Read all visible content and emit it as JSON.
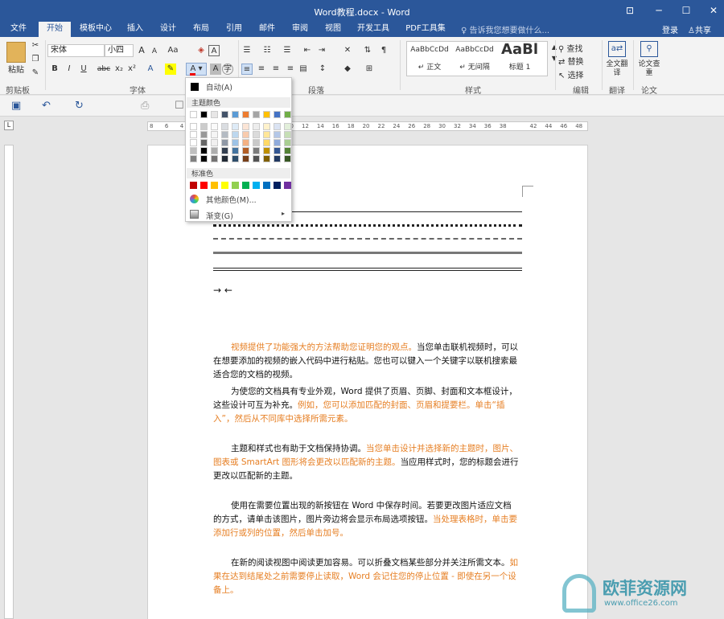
{
  "title": "Word教程.docx - Word",
  "window_controls": [
    "⊡",
    "─",
    "☐",
    "✕"
  ],
  "tabs": [
    "文件",
    "开始",
    "模板中心",
    "插入",
    "设计",
    "布局",
    "引用",
    "邮件",
    "审阅",
    "视图",
    "开发工具",
    "PDF工具集"
  ],
  "tellme": "告诉我您想要做什么...",
  "login": "登录",
  "share": "共享",
  "clipboard": {
    "paste": "粘贴",
    "label": "剪贴板"
  },
  "font": {
    "name": "宋体",
    "size": "小四",
    "label": "字体",
    "grow": "A",
    "shrink": "A",
    "case": "Aa",
    "bold": "B",
    "italic": "I",
    "underline": "U",
    "strike": "abc",
    "sub": "x₂",
    "sup": "x²"
  },
  "paragraph": {
    "label": "段落"
  },
  "styles": {
    "label": "样式",
    "items": [
      {
        "preview": "AaBbCcDd",
        "name": "↵ 正文"
      },
      {
        "preview": "AaBbCcDd",
        "name": "↵ 无间隔"
      },
      {
        "preview": "AaBl",
        "name": "标题 1"
      }
    ]
  },
  "editing": {
    "label": "编辑",
    "find": "查找",
    "replace": "替换",
    "select": "选择"
  },
  "translate": {
    "label": "翻译",
    "btn": "全文翻译"
  },
  "paper": {
    "label": "论文",
    "btn": "论文查重"
  },
  "ruler_ticks": [
    "8",
    "6",
    "4",
    "2",
    "",
    "2",
    "4",
    "6",
    "8",
    "10",
    "12",
    "14",
    "16",
    "18",
    "20",
    "22",
    "24",
    "26",
    "28",
    "30",
    "32",
    "34",
    "36",
    "38",
    "",
    "42",
    "44",
    "46",
    "48"
  ],
  "color_menu": {
    "auto": "自动(A)",
    "theme_title": "主题颜色",
    "standard_title": "标准色",
    "more": "其他颜色(M)...",
    "gradient": "渐变(G)",
    "theme_colors": [
      "#ffffff",
      "#000000",
      "#e7e6e6",
      "#44546a",
      "#5b9bd5",
      "#ed7d31",
      "#a5a5a5",
      "#ffc000",
      "#4472c4",
      "#70ad47"
    ],
    "standard_colors": [
      "#c00000",
      "#ff0000",
      "#ffc000",
      "#ffff00",
      "#92d050",
      "#00b050",
      "#00b0f0",
      "#0070c0",
      "#002060",
      "#7030a0"
    ]
  },
  "doc": {
    "arrows": "→ ←",
    "p1": [
      {
        "t": "视频提供了功能强大的方法帮助您证明您的观点。",
        "o": true
      },
      {
        "t": "当您单击联机视频时，可以在想要添加的视频的嵌入代码中进行粘贴。您也可以键入一个关键字以联机搜索最适合您的文档的视频。",
        "o": false
      }
    ],
    "p2": [
      {
        "t": "为使您的文档具有专业外观，Word 提供了页眉、页脚、封面和文本框设计，这些设计可互为补充。",
        "o": false
      },
      {
        "t": "例如，您可以添加匹配的封面、页眉和提要栏。单击“插入”，然后从不同库中选择所需元素。",
        "o": true
      }
    ],
    "p3": [
      {
        "t": "主题和样式也有助于文档保持协调。",
        "o": false
      },
      {
        "t": "当您单击设计并选择新的主题时，图片、图表或 SmartArt 图形将会更改以匹配新的主题。",
        "o": true
      },
      {
        "t": "当应用样式时，您的标题会进行更改以匹配新的主题。",
        "o": false
      }
    ],
    "p4": [
      {
        "t": "使用在需要位置出现的新按钮在 Word 中保存时间。若要更改图片适应文档的方式，请单击该图片，图片旁边将会显示布局选项按钮。",
        "o": false
      },
      {
        "t": "当处理表格时，单击要添加行或列的位置，然后单击加号。",
        "o": true
      }
    ],
    "p5": [
      {
        "t": "在新的阅读视图中阅读更加容易。可以折叠文档某些部分并关注所需文本。",
        "o": false
      },
      {
        "t": "如果在达到结尾处之前需要停止读取，Word 会记住您的停止位置 - 即使在另一个设备上。",
        "o": true
      }
    ]
  },
  "watermark": {
    "text": "欧菲资源网",
    "url": "www.office26.com"
  }
}
